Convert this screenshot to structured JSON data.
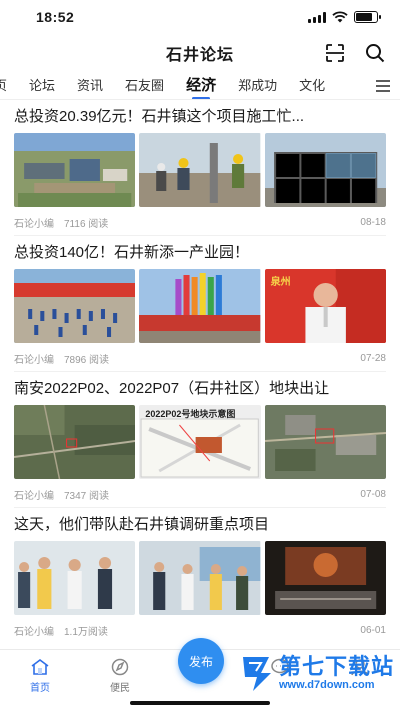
{
  "status_bar": {
    "time": "18:52"
  },
  "header": {
    "title": "石井论坛"
  },
  "tabs": [
    {
      "label": "页"
    },
    {
      "label": "论坛"
    },
    {
      "label": "资讯"
    },
    {
      "label": "石友圈"
    },
    {
      "label": "经济",
      "active": true
    },
    {
      "label": "郑成功"
    },
    {
      "label": "文化"
    }
  ],
  "articles": [
    {
      "title": "总投资20.39亿元！石井镇这个项目施工忙...",
      "author": "石论小编",
      "reads": "7116 阅读",
      "date": "08-18"
    },
    {
      "title": "总投资140亿！石井新添一产业园！",
      "author": "石论小编",
      "reads": "7896 阅读",
      "date": "07-28"
    },
    {
      "title": "南安2022P02、2022P07（石井社区）地块出让",
      "author": "石论小编",
      "reads": "7347 阅读",
      "date": "07-08"
    },
    {
      "title": "这天，他们带队赴石井镇调研重点项目",
      "author": "石论小编",
      "reads": "1.1万阅读",
      "date": "06-01"
    }
  ],
  "image_text": {
    "map_caption": "2022P02号地块示意图",
    "banner_text": "泉州"
  },
  "bottom_nav": {
    "home": "首页",
    "service": "便民",
    "publish": "发布",
    "messages": "",
    "profile": ""
  },
  "watermark": {
    "name": "第七下载站",
    "url": "www.d7down.com"
  },
  "colors": {
    "accent": "#2f6fe8",
    "publish": "#2f8ef0"
  }
}
